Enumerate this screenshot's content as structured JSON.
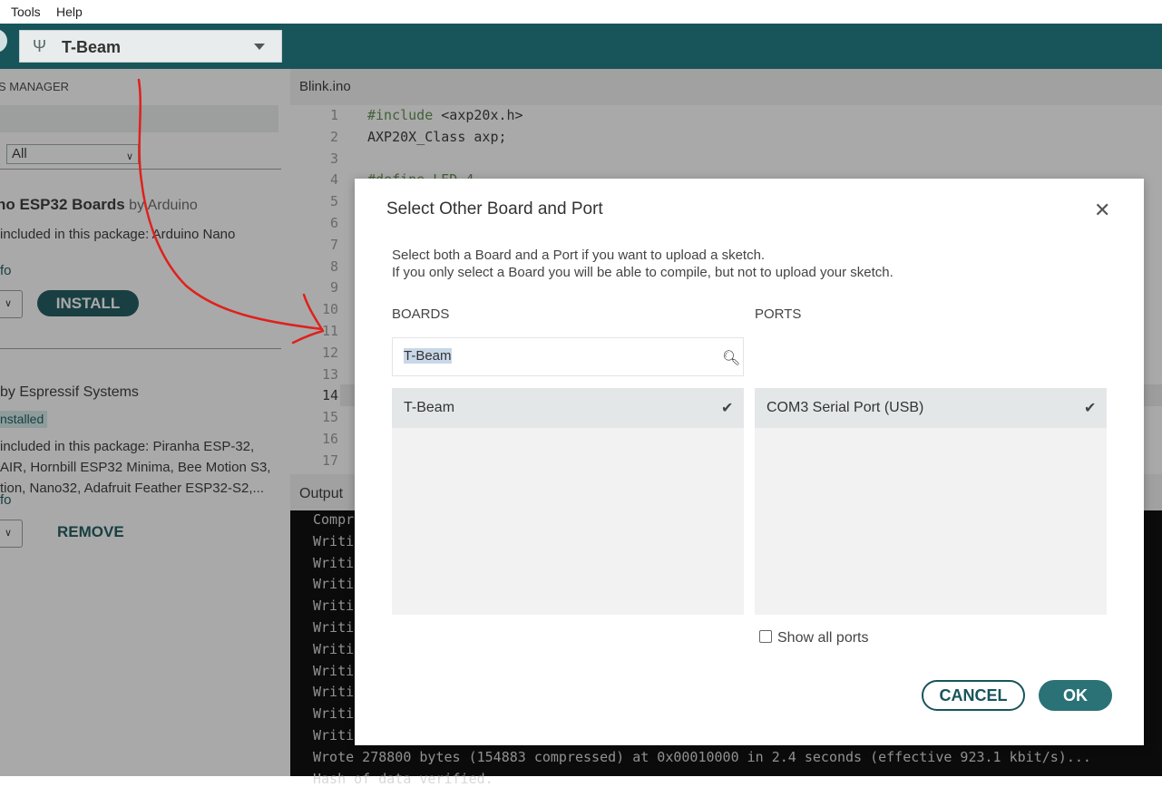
{
  "menubar": {
    "items": [
      "Tools",
      "Help"
    ]
  },
  "toolbar": {
    "board_name": "T-Beam",
    "usb_icon": "usb-icon"
  },
  "sidebar": {
    "header": "S MANAGER",
    "filter_value": "All",
    "package1": {
      "title": "no ESP32 Boards",
      "by": " by Arduino",
      "included": "included in this package: Arduino Nano",
      "info": "fo",
      "install_label": "INSTALL"
    },
    "package2": {
      "title": "by Espressif Systems",
      "installed_badge": "nstalled",
      "included_lines": [
        "included in this package: Piranha ESP-32,",
        "AIR, Hornbill ESP32 Minima, Bee Motion S3,",
        "tion, Nano32, Adafruit Feather ESP32-S2,..."
      ],
      "info": "fo",
      "remove_label": "REMOVE"
    }
  },
  "editor": {
    "tab_name": "Blink.ino",
    "line_numbers": [
      "1",
      "2",
      "3",
      "4",
      "5",
      "6",
      "7",
      "8",
      "9",
      "10",
      "11",
      "12",
      "13",
      "14",
      "15",
      "16",
      "17"
    ],
    "code": {
      "line1_kw": "#include",
      "line1_rest": " <axp20x.h>",
      "line2": "AXP20X_Class axp;",
      "line4": "#define LED 4"
    }
  },
  "output": {
    "label": "Output",
    "lines": [
      "Compr",
      "Writi",
      "Writi",
      "Writi",
      "Writi",
      "Writi",
      "Writi",
      "Writi",
      "Writi",
      "Writi",
      "Writi",
      "Wrote 278800 bytes (154883 compressed) at 0x00010000 in 2.4 seconds (effective 923.1 kbit/s)...",
      "Hash of data verified."
    ]
  },
  "dialog": {
    "title": "Select Other Board and Port",
    "close_icon": "close-icon",
    "description_line1": "Select both a Board and a Port if you want to upload a sketch.",
    "description_line2": "If you only select a Board you will be able to compile, but not to upload your sketch.",
    "boards_header": "BOARDS",
    "ports_header": "PORTS",
    "boards_search_value": "T-Beam",
    "boards_list": [
      {
        "label": "T-Beam",
        "selected": true
      }
    ],
    "ports_list": [
      {
        "label": "COM3 Serial Port (USB)",
        "selected": true
      }
    ],
    "show_all_ports_label": "Show all ports",
    "show_all_ports_checked": false,
    "cancel_label": "CANCEL",
    "ok_label": "OK"
  },
  "colors": {
    "toolbar": "#17555a",
    "accent": "#17555a",
    "ok_button": "#2a7276",
    "annotation_arrow": "#e0201c"
  }
}
